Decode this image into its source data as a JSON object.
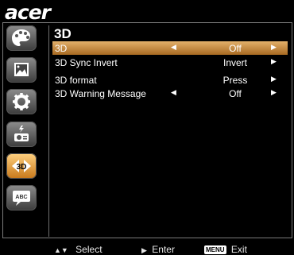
{
  "brand": {
    "logo": "acer"
  },
  "menu": {
    "title": "3D",
    "rows": [
      {
        "label": "3D",
        "value": "Off",
        "left_arrow": true,
        "right_arrow": true,
        "selected": true
      },
      {
        "label": "3D Sync Invert",
        "value": "Invert",
        "left_arrow": false,
        "right_arrow": true,
        "selected": false
      },
      {
        "label": "3D format",
        "value": "Press",
        "left_arrow": false,
        "right_arrow": true,
        "selected": false
      },
      {
        "label": "3D Warning Message",
        "value": "Off",
        "left_arrow": true,
        "right_arrow": true,
        "selected": false
      }
    ]
  },
  "sidebar": {
    "items": [
      {
        "icon": "palette-icon",
        "active": false
      },
      {
        "icon": "picture-icon",
        "active": false
      },
      {
        "icon": "gear-icon",
        "active": false
      },
      {
        "icon": "projector-management-icon",
        "active": false
      },
      {
        "icon": "3d-icon",
        "active": true,
        "text": "3D"
      },
      {
        "icon": "language-icon",
        "active": false,
        "text": "ABC"
      }
    ]
  },
  "footer": {
    "select_label": "Select",
    "enter_label": "Enter",
    "menu_key": "MENU",
    "exit_label": "Exit"
  },
  "colors": {
    "selected_row": "#c8781a",
    "icon_gray": "#6a6a6a",
    "background": "#000000"
  }
}
